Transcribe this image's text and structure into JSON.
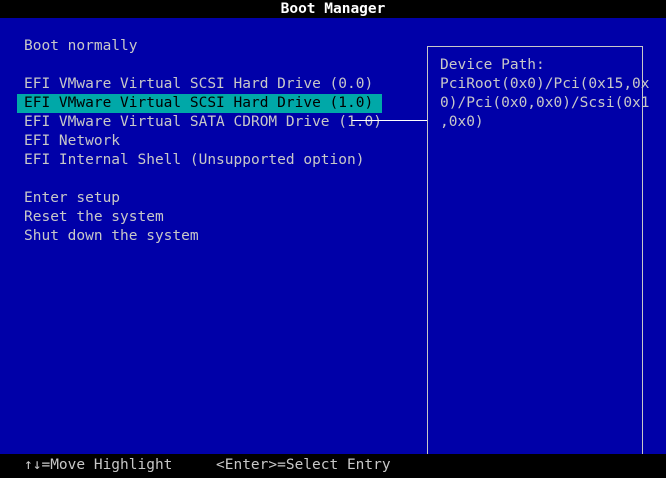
{
  "title": "Boot Manager",
  "menu": {
    "items": [
      {
        "label": "Boot normally"
      },
      {
        "label": "EFI VMware Virtual SCSI Hard Drive (0.0)"
      },
      {
        "label": "EFI VMware Virtual SCSI Hard Drive (1.0)",
        "selected": true
      },
      {
        "label": "EFI VMware Virtual SATA CDROM Drive (1.0)"
      },
      {
        "label": "EFI Network"
      },
      {
        "label": "EFI Internal Shell (Unsupported option)"
      },
      {
        "label": "Enter setup"
      },
      {
        "label": "Reset the system"
      },
      {
        "label": "Shut down the system"
      }
    ]
  },
  "info_panel": {
    "label": "Device Path:",
    "lines": [
      "PciRoot(0x0)/Pci(0x15,0x",
      "0)/Pci(0x0,0x0)/Scsi(0x1",
      ",0x0)"
    ]
  },
  "footer": {
    "move_hint": "↑↓=Move Highlight",
    "select_hint": "<Enter>=Select Entry"
  },
  "colors": {
    "background": "#0000a8",
    "highlight": "#00a8a8",
    "text": "#c8c8c8"
  }
}
